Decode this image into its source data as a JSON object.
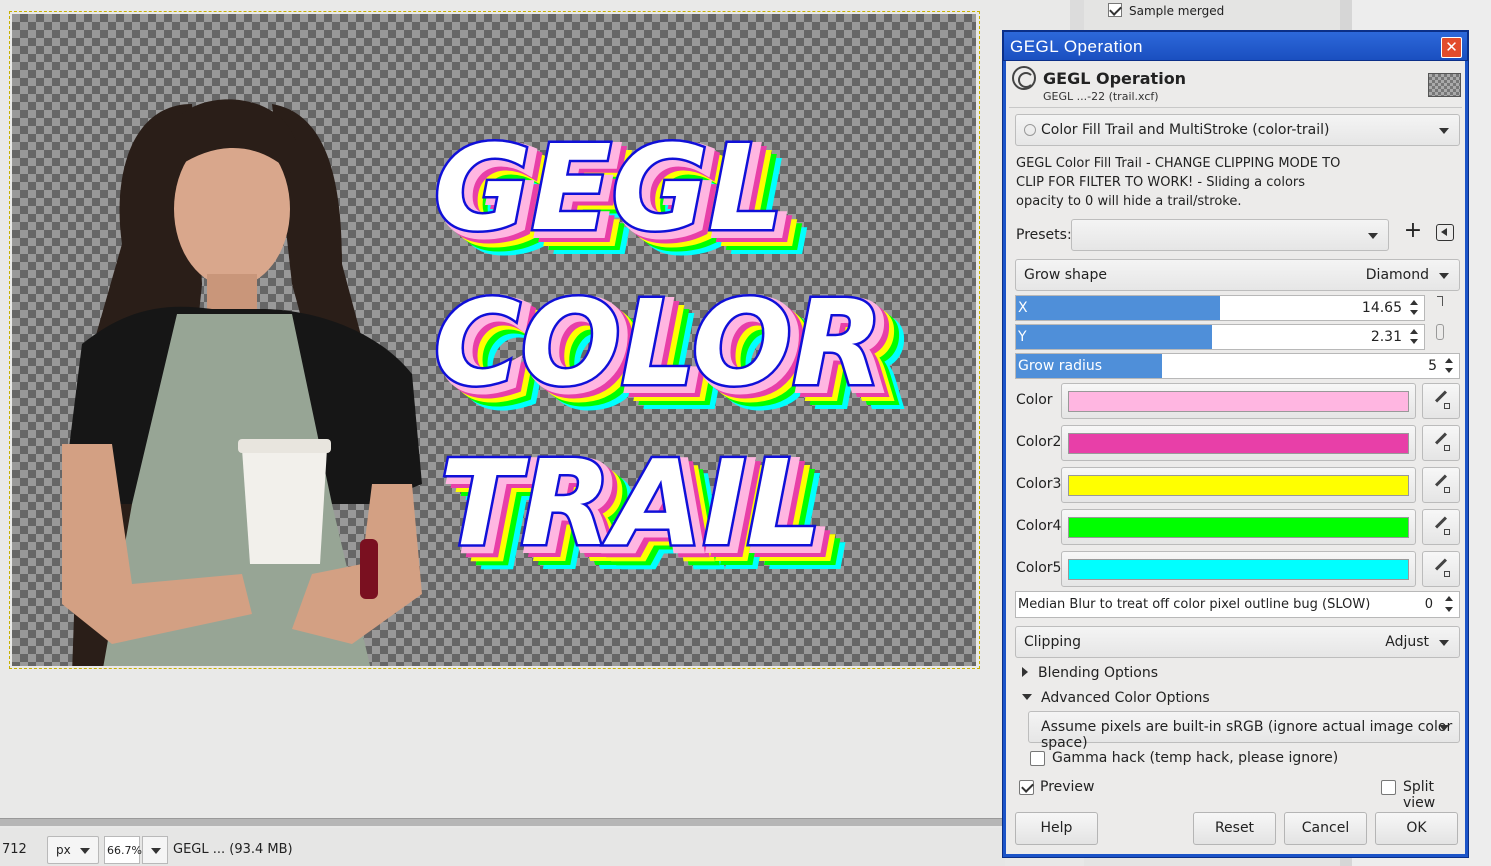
{
  "statusbar": {
    "coord": "712",
    "unit": "px",
    "zoom": "66.7%",
    "title": "GEGL ... (93.4 MB)"
  },
  "dock": {
    "sample_merged": "Sample merged"
  },
  "canvas": {
    "art_lines": [
      "GEGL",
      "COLOR",
      "TRAIL"
    ]
  },
  "dialog": {
    "window_title": "GEGL Operation",
    "close_glyph": "✕",
    "header_title": "GEGL Operation",
    "header_subtitle": "GEGL  ...-22 (trail.xcf)",
    "operation": "Color Fill Trail and MultiStroke (color-trail)",
    "description_lines": [
      "GEGL Color Fill Trail - CHANGE CLIPPING MODE TO",
      "CLIP FOR FILTER TO WORK! - Sliding a colors",
      "opacity to 0 will hide a trail/stroke."
    ],
    "presets_label": "Presets:",
    "presets_value": "",
    "grow_shape": {
      "label": "Grow shape",
      "value": "Diamond"
    },
    "x": {
      "label": "X",
      "value": "14.65",
      "fill": 0.5
    },
    "y": {
      "label": "Y",
      "value": "2.31",
      "fill": 0.48
    },
    "grow_radius": {
      "label": "Grow radius",
      "value": "5",
      "fill": 0.33
    },
    "colors": [
      {
        "label": "Color",
        "hex": "#ffb6e1"
      },
      {
        "label": "Color2",
        "hex": "#e83fa8"
      },
      {
        "label": "Color3",
        "hex": "#ffff00"
      },
      {
        "label": "Color4",
        "hex": "#00ff00"
      },
      {
        "label": "Color5",
        "hex": "#00ffff"
      }
    ],
    "median": {
      "label": "Median Blur to treat off color pixel outline bug (SLOW)",
      "value": "0"
    },
    "clipping": {
      "label": "Clipping",
      "value": "Adjust"
    },
    "blending_options": "Blending Options",
    "advanced_color_options": "Advanced Color Options",
    "color_space": "Assume pixels are built-in sRGB (ignore actual image color space)",
    "gamma_hack": "Gamma hack (temp hack, please ignore)",
    "preview": "Preview",
    "split_view": "Split view",
    "buttons": {
      "help": "Help",
      "reset": "Reset",
      "cancel": "Cancel",
      "ok": "OK"
    }
  },
  "colors": {
    "accent": "#4f8fd9",
    "titlebar": "#1a4fc0"
  }
}
